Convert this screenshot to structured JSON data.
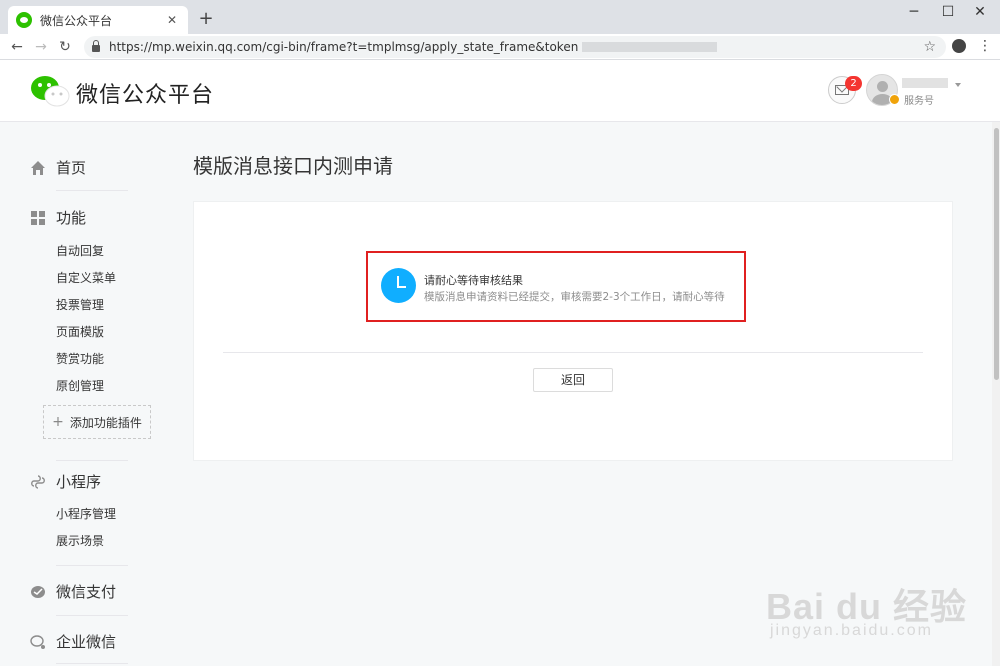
{
  "browser": {
    "tab_title": "微信公众平台",
    "url": "https://mp.weixin.qq.com/cgi-bin/frame?t=tmplmsg/apply_state_frame&token"
  },
  "header": {
    "logo_text": "微信公众平台",
    "mail_badge": "2",
    "account_type": "服务号"
  },
  "sidebar": {
    "home": "首页",
    "features": {
      "label": "功能",
      "items": [
        "自动回复",
        "自定义菜单",
        "投票管理",
        "页面模版",
        "赞赏功能",
        "原创管理"
      ],
      "add_plugin": "添加功能插件"
    },
    "miniprogram": {
      "label": "小程序",
      "items": [
        "小程序管理",
        "展示场景"
      ]
    },
    "wechat_pay": "微信支付",
    "enterprise_wechat": "企业微信"
  },
  "main": {
    "title": "模版消息接口内测申请",
    "notice_title": "请耐心等待审核结果",
    "notice_desc": "模版消息申请资料已经提交，审核需要2-3个工作日，请耐心等待",
    "back_button": "返回"
  },
  "watermark": {
    "main": "Bai du 经验",
    "sub": "jingyan.baidu.com"
  },
  "colors": {
    "brand_green": "#2dc100",
    "clock_blue": "#10aeff",
    "highlight_red": "#e02020",
    "badge_red": "#f43530"
  }
}
